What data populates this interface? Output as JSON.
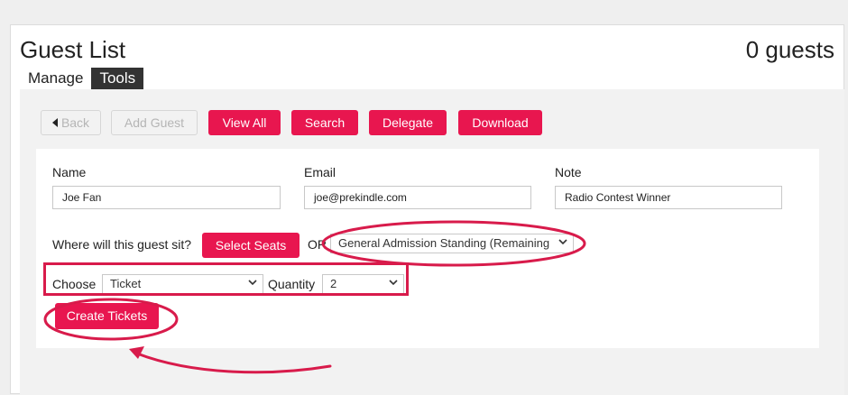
{
  "header": {
    "title": "Guest List",
    "guest_count": "0 guests"
  },
  "tabs": [
    {
      "label": "Manage",
      "active": false
    },
    {
      "label": "Tools",
      "active": true
    }
  ],
  "toolbar": {
    "back_label": "Back",
    "add_guest_label": "Add Guest",
    "view_all_label": "View All",
    "search_label": "Search",
    "delegate_label": "Delegate",
    "download_label": "Download"
  },
  "form": {
    "name_label": "Name",
    "name_value": "Joe Fan",
    "email_label": "Email",
    "email_value": "joe@prekindle.com",
    "note_label": "Note",
    "note_value": "Radio Contest Winner",
    "seat_question": "Where will this guest sit?",
    "select_seats_label": "Select Seats",
    "or_label": "OR",
    "ga_select_value": "General Admission Standing (Remaining",
    "choose_label": "Choose",
    "ticket_select_value": "Ticket",
    "quantity_label": "Quantity",
    "quantity_value": "2",
    "create_tickets_label": "Create Tickets"
  },
  "colors": {
    "accent": "#e8164f",
    "annotation": "#d81b4b",
    "active_tab": "#333333",
    "panel_bg": "#f2f2f2"
  },
  "icons": {
    "back": "caret-left-icon",
    "dropdown": "chevron-down-icon"
  }
}
